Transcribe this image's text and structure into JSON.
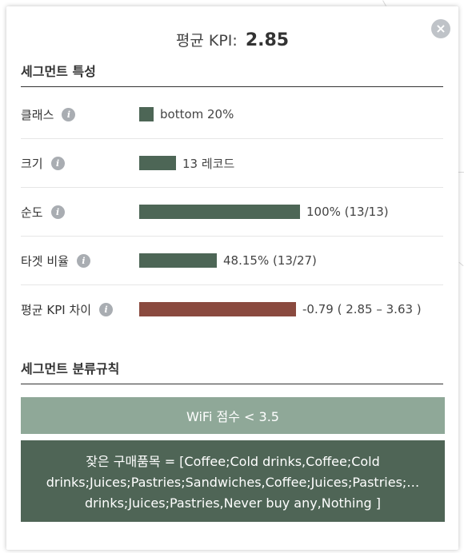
{
  "popup": {
    "kpi_label": "평균 KPI:",
    "kpi_value": "2.85",
    "close_symbol": "×"
  },
  "segment_traits": {
    "heading": "세그먼트 특성",
    "rows": [
      {
        "label": "클래스",
        "value_text": "bottom 20%",
        "bar_color": "#4d6656"
      },
      {
        "label": "크기",
        "value_text": "13 레코드",
        "bar_color": "#4d6656"
      },
      {
        "label": "순도",
        "value_text": "100% (13/13)",
        "bar_color": "#4d6656",
        "fill_percent": 100
      },
      {
        "label": "타겟 비율",
        "value_text": "48.15% (13/27)",
        "bar_color": "#4d6656",
        "fill_percent": 48.15
      },
      {
        "label": "평균 KPI 차이",
        "value_text": "-0.79 ( 2.85 – 3.63 )",
        "bar_color": "#8a4a3f"
      }
    ]
  },
  "segment_rules": {
    "heading": "세그먼트 분류규칙",
    "rule_1": "WiFi 점수 < 3.5",
    "rule_2_lines": [
      "잦은 구매품목 = [Coffee;Cold drinks,Coffee;Cold",
      "drinks;Juices;Pastries;Sandwiches,Coffee;Juices;Pastries;…",
      "drinks;Juices;Pastries,Never buy any,Nothing ]"
    ],
    "rule_1_color": "#8fa898",
    "rule_2_color": "#4f6556"
  }
}
